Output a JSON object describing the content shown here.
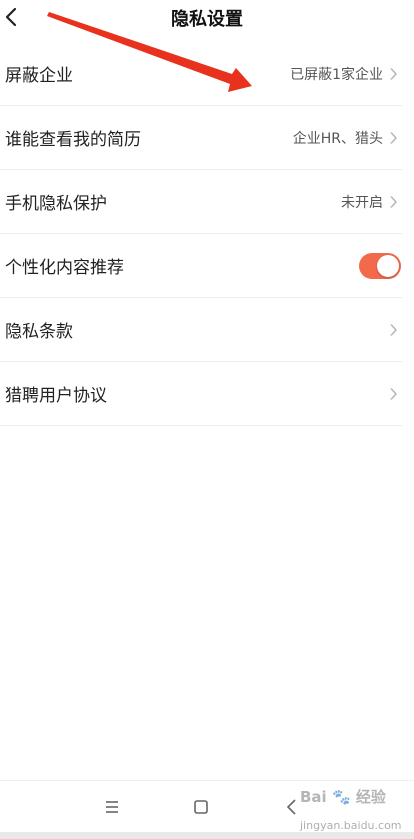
{
  "header": {
    "title": "隐私设置",
    "back_icon": "chevron-left-icon"
  },
  "settings": [
    {
      "label": "屏蔽企业",
      "value": "已屏蔽1家企业",
      "control": "chevron"
    },
    {
      "label": "谁能查看我的简历",
      "value": "企业HR、猎头",
      "control": "chevron"
    },
    {
      "label": "手机隐私保护",
      "value": "未开启",
      "control": "chevron"
    },
    {
      "label": "个性化内容推荐",
      "value": "",
      "control": "toggle",
      "toggle_on": true
    },
    {
      "label": "隐私条款",
      "value": "",
      "control": "chevron"
    },
    {
      "label": "猎聘用户协议",
      "value": "",
      "control": "chevron"
    }
  ],
  "colors": {
    "toggle_on": "#f26a4b",
    "annotation_arrow": "#e8321e",
    "divider": "#ececec"
  },
  "navbar": {
    "icons": [
      "menu-icon",
      "home-square-icon",
      "back-triangle-icon"
    ]
  },
  "watermark": {
    "brand": "Bai",
    "brand_cn": "经验",
    "site": "jingyan.baidu.com"
  }
}
